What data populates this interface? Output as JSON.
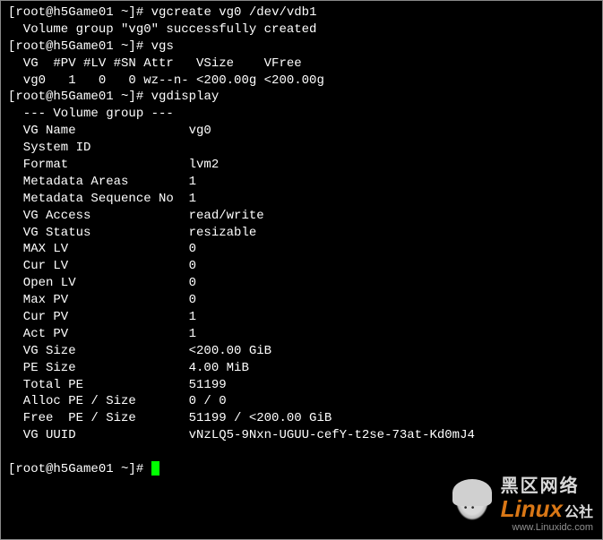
{
  "prompts": {
    "p1": "[root@h5Game01 ~]# ",
    "p2": "[root@h5Game01 ~]# ",
    "p3": "[root@h5Game01 ~]# ",
    "p4": "[root@h5Game01 ~]# "
  },
  "commands": {
    "cmd1": "vgcreate vg0 /dev/vdb1",
    "cmd2": "vgs",
    "cmd3": "vgdisplay"
  },
  "output": {
    "vgcreate_result": "  Volume group \"vg0\" successfully created",
    "vgs_header": "  VG  #PV #LV #SN Attr   VSize    VFree   ",
    "vgs_row": "  vg0   1   0   0 wz--n- <200.00g <200.00g",
    "vgd": {
      "header": "  --- Volume group ---",
      "vg_name": "  VG Name               vg0",
      "system_id": "  System ID             ",
      "format": "  Format                lvm2",
      "metadata_areas": "  Metadata Areas        1",
      "metadata_seq": "  Metadata Sequence No  1",
      "vg_access": "  VG Access             read/write",
      "vg_status": "  VG Status             resizable",
      "max_lv": "  MAX LV                0",
      "cur_lv": "  Cur LV                0",
      "open_lv": "  Open LV               0",
      "max_pv": "  Max PV                0",
      "cur_pv": "  Cur PV                1",
      "act_pv": "  Act PV                1",
      "vg_size": "  VG Size               <200.00 GiB",
      "pe_size": "  PE Size               4.00 MiB",
      "total_pe": "  Total PE              51199",
      "alloc_pe": "  Alloc PE / Size       0 / 0   ",
      "free_pe": "  Free  PE / Size       51199 / <200.00 GiB",
      "vg_uuid": "  VG UUID               vNzLQ5-9Nxn-UGUU-cefY-t2se-73at-Kd0mJ4",
      "blank": "   "
    }
  },
  "watermark": {
    "cn": "黑区网络",
    "brand": "Linux",
    "suffix": "公社",
    "url": "www.Linuxidc.com"
  },
  "chart_data": {
    "type": "table",
    "title": "vgs output",
    "columns": [
      "VG",
      "#PV",
      "#LV",
      "#SN",
      "Attr",
      "VSize",
      "VFree"
    ],
    "rows": [
      [
        "vg0",
        1,
        0,
        0,
        "wz--n-",
        "<200.00g",
        "<200.00g"
      ]
    ],
    "vgdisplay": {
      "VG Name": "vg0",
      "System ID": "",
      "Format": "lvm2",
      "Metadata Areas": 1,
      "Metadata Sequence No": 1,
      "VG Access": "read/write",
      "VG Status": "resizable",
      "MAX LV": 0,
      "Cur LV": 0,
      "Open LV": 0,
      "Max PV": 0,
      "Cur PV": 1,
      "Act PV": 1,
      "VG Size": "<200.00 GiB",
      "PE Size": "4.00 MiB",
      "Total PE": 51199,
      "Alloc PE / Size": "0 / 0",
      "Free PE / Size": "51199 / <200.00 GiB",
      "VG UUID": "vNzLQ5-9Nxn-UGUU-cefY-t2se-73at-Kd0mJ4"
    }
  }
}
